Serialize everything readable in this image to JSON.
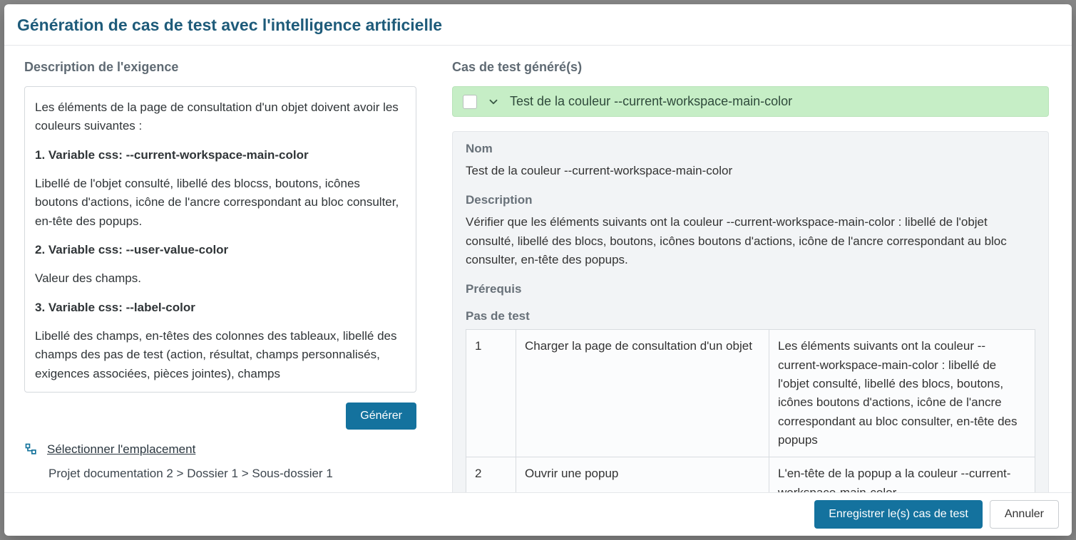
{
  "modal": {
    "title": "Génération de cas de test avec l'intelligence artificielle"
  },
  "left": {
    "heading": "Description de l'exigence",
    "requirement": {
      "intro": "Les éléments de la page de consultation d'un objet doivent avoir les couleurs suivantes :",
      "var1_title": "1. Variable css: --current-workspace-main-color",
      "var1_body": "Libellé de l'objet consulté,  libellé des blocss, boutons, icônes boutons d'actions, icône de l'ancre correspondant au bloc consulter, en-tête des popups.",
      "var2_title": "2. Variable css: --user-value-color",
      "var2_body": "Valeur des champs.",
      "var3_title": "3. Variable css: --label-color",
      "var3_body": "Libellé des champs, en-têtes des colonnes des tableaux, libellé des champs des pas de test (action, résultat, champs personnalisés, exigences associées, pièces jointes), champs"
    },
    "generate_label": "Générer",
    "select_location_label": "Sélectionner l'emplacement",
    "breadcrumb": "Projet documentation 2 > Dossier 1 > Sous-dossier 1"
  },
  "right": {
    "heading": "Cas de test généré(s)",
    "testcase": {
      "header_title": "Test de la couleur --current-workspace-main-color",
      "name_label": "Nom",
      "name_value": "Test de la couleur --current-workspace-main-color",
      "desc_label": "Description",
      "desc_value": "Vérifier que les éléments suivants ont la couleur --current-workspace-main-color : libellé de l'objet consulté, libellé des blocs, boutons, icônes boutons d'actions, icône de l'ancre correspondant au bloc consulter, en-tête des popups.",
      "prereq_label": "Prérequis",
      "steps_label": "Pas de test",
      "steps": [
        {
          "idx": "1",
          "action": "Charger la page de consultation d'un objet",
          "result": "Les éléments suivants ont la couleur --current-workspace-main-color : libellé de l'objet consulté, libellé des blocs, boutons, icônes boutons d'actions, icône de l'ancre correspondant au bloc consulter, en-tête des popups"
        },
        {
          "idx": "2",
          "action": "Ouvrir une popup",
          "result": "L'en-tête de la popup a la couleur --current-workspace-main-color"
        }
      ]
    }
  },
  "footer": {
    "save_label": "Enregistrer le(s) cas de test",
    "cancel_label": "Annuler"
  }
}
